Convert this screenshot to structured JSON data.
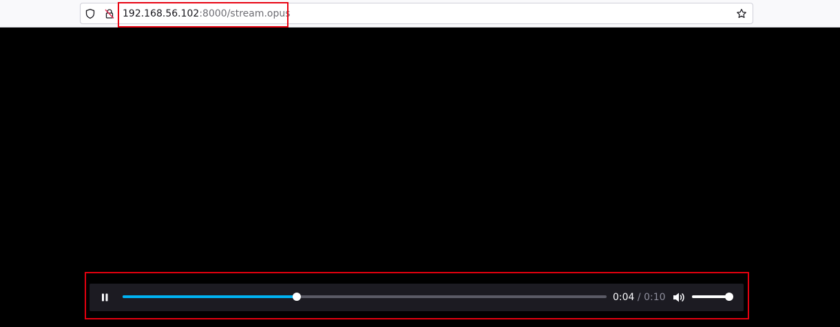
{
  "browser": {
    "url_host": "192.168.56.102",
    "url_rest": ":8000/stream.opus",
    "icons": [
      "shield-icon",
      "insecure-lock-icon",
      "bookmark-star-icon"
    ]
  },
  "player": {
    "state": "playing",
    "current_time": "0:04",
    "separator": " / ",
    "total_time": "0:10",
    "progress_fraction": 0.36,
    "volume_fraction": 0.98,
    "colors": {
      "progress": "#00b3f4",
      "controls_bg": "#1c1b22",
      "highlight": "#e8000f"
    },
    "icons": [
      "pause-icon",
      "volume-icon"
    ]
  }
}
